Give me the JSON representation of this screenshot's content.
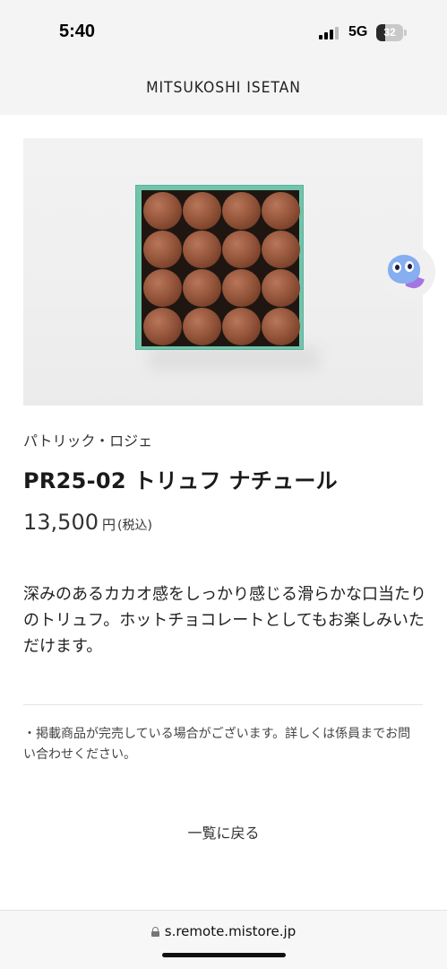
{
  "status_bar": {
    "time": "5:40",
    "network": "5G",
    "battery_level": "32",
    "signal_icon": "cellular-signal-icon",
    "battery_icon": "battery-icon"
  },
  "header": {
    "brand": "MITSUKOSHI ISETAN"
  },
  "product": {
    "image_icon": "product-photo-truffle-box",
    "brand_name": "パトリック・ロジェ",
    "title": "PR25-02 トリュフ ナチュール",
    "price": "13,500",
    "price_unit": "円",
    "price_tax": "(税込)",
    "description": "深みのあるカカオ感をしっかり感じる滑らかな口当たりのトリュフ。ホットチョコレートとしてもお楽しみいただけます。",
    "notice": "・掲載商品が完売している場合がございます。詳しくは係員までお問い合わせください。"
  },
  "actions": {
    "back_label": "一覧に戻る"
  },
  "assistant": {
    "icon": "chat-mascot-icon"
  },
  "browser": {
    "url": "s.remote.mistore.jp",
    "lock_icon": "lock-icon"
  },
  "colors": {
    "box_teal": "#71c4ac",
    "header_bg": "#f4f4f4",
    "mascot_blue": "#86aef0"
  }
}
